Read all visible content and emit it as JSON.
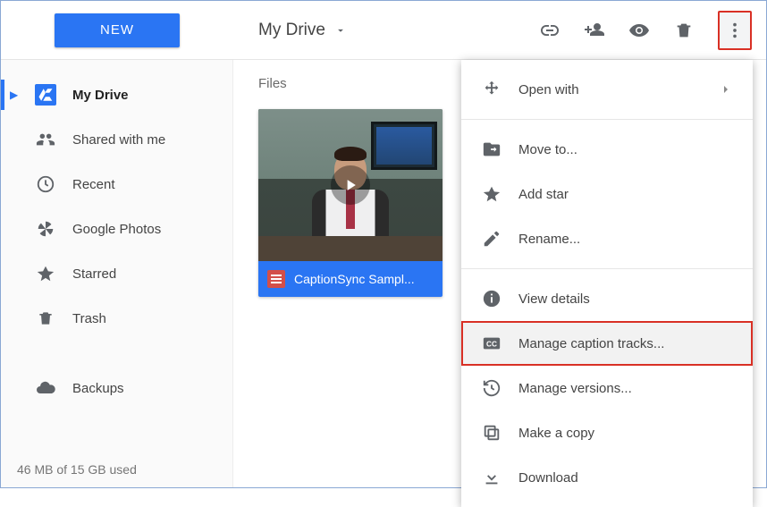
{
  "topbar": {
    "new_label": "NEW",
    "breadcrumb": "My Drive"
  },
  "sidebar": {
    "items": [
      {
        "label": "My Drive"
      },
      {
        "label": "Shared with me"
      },
      {
        "label": "Recent"
      },
      {
        "label": "Google Photos"
      },
      {
        "label": "Starred"
      },
      {
        "label": "Trash"
      }
    ],
    "backups_label": "Backups",
    "storage_text": "46 MB of 15 GB used"
  },
  "main": {
    "section_label": "Files",
    "files": [
      {
        "title": "CaptionSync Sampl..."
      }
    ]
  },
  "context_menu": {
    "items": [
      {
        "label": "Open with",
        "has_submenu": true
      },
      {
        "sep": true
      },
      {
        "label": "Move to..."
      },
      {
        "label": "Add star"
      },
      {
        "label": "Rename..."
      },
      {
        "sep": true
      },
      {
        "label": "View details"
      },
      {
        "label": "Manage caption tracks...",
        "highlight": true
      },
      {
        "label": "Manage versions..."
      },
      {
        "label": "Make a copy"
      },
      {
        "label": "Download"
      }
    ]
  }
}
